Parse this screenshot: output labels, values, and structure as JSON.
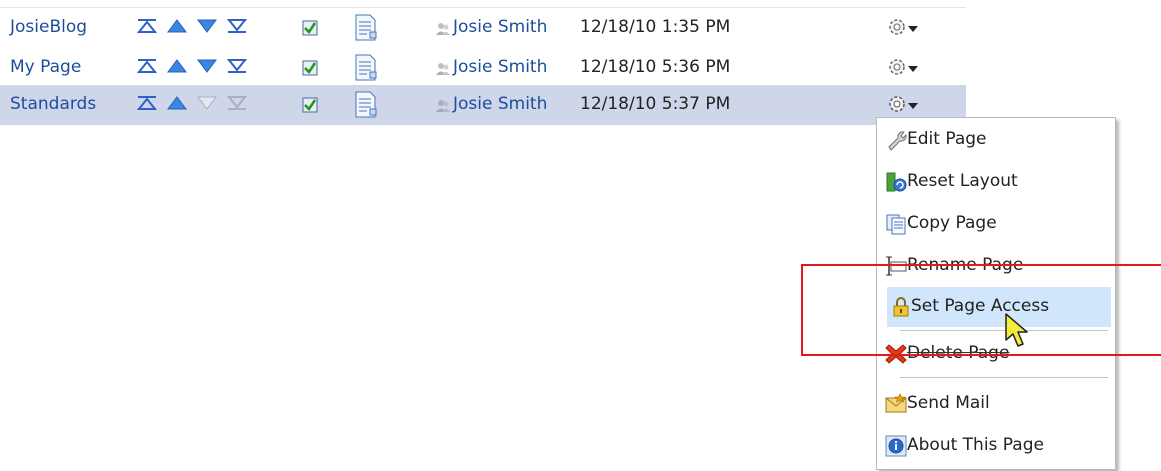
{
  "rows": [
    {
      "name": "JosieBlog",
      "owner": "Josie Smith",
      "date": "12/18/10 1:35 PM",
      "selected": false,
      "down_enabled": true
    },
    {
      "name": "My Page",
      "owner": "Josie Smith",
      "date": "12/18/10 5:36 PM",
      "selected": false,
      "down_enabled": true
    },
    {
      "name": "Standards",
      "owner": "Josie Smith",
      "date": "12/18/10 5:37 PM",
      "selected": true,
      "down_enabled": false
    }
  ],
  "icons": {
    "move_top": "move-to-top-icon",
    "move_up": "move-up-icon",
    "move_down": "move-down-icon",
    "move_bottom": "move-to-bottom-icon",
    "visible": "checkbox-checked-icon",
    "properties": "page-properties-icon",
    "owner": "user-icon",
    "actions": "gear-menu-icon"
  },
  "menu": {
    "items": [
      {
        "label": "Edit Page",
        "icon": "wrench-icon"
      },
      {
        "label": "Reset Layout",
        "icon": "reset-layout-icon"
      },
      {
        "label": "Copy Page",
        "icon": "copy-icon"
      },
      {
        "label": "Rename Page",
        "icon": "rename-icon"
      },
      {
        "label": "Set Page Access",
        "icon": "lock-icon",
        "highlighted": true
      },
      {
        "label": "Delete Page",
        "icon": "delete-x-icon"
      },
      {
        "label": "Send Mail",
        "icon": "envelope-icon"
      },
      {
        "label": "About This Page",
        "icon": "info-icon"
      }
    ]
  },
  "colors": {
    "link": "#1b4f9c",
    "selected_row": "#cfd6ea",
    "menu_highlight": "#cfe6fb",
    "annotation": "#e11b1b"
  }
}
